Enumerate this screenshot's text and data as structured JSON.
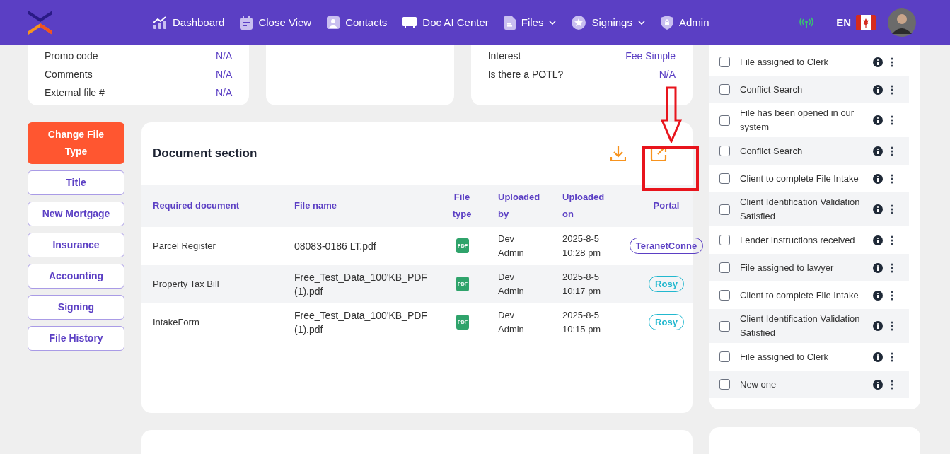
{
  "nav": {
    "items": [
      {
        "label": "Dashboard",
        "dropdown": false
      },
      {
        "label": "Close View",
        "dropdown": false
      },
      {
        "label": "Contacts",
        "dropdown": false
      },
      {
        "label": "Doc AI Center",
        "dropdown": false
      },
      {
        "label": "Files",
        "dropdown": true
      },
      {
        "label": "Signings",
        "dropdown": true
      },
      {
        "label": "Admin",
        "dropdown": false
      }
    ],
    "language": "EN"
  },
  "summary_cards": [
    {
      "rows": [
        {
          "label": "Promo code",
          "value": "N/A"
        },
        {
          "label": "Comments",
          "value": "N/A"
        },
        {
          "label": "External file #",
          "value": "N/A"
        }
      ]
    },
    {
      "rows": [
        {
          "label": "Interest",
          "value": "Fee Simple"
        },
        {
          "label": "Is there a POTL?",
          "value": "N/A"
        }
      ]
    }
  ],
  "side_buttons": [
    {
      "label": "Change File Type",
      "kind": "primary"
    },
    {
      "label": "Title",
      "kind": "outline"
    },
    {
      "label": "New Mortgage",
      "kind": "outline"
    },
    {
      "label": "Insurance",
      "kind": "outline"
    },
    {
      "label": "Accounting",
      "kind": "outline"
    },
    {
      "label": "Signing",
      "kind": "outline"
    },
    {
      "label": "File History",
      "kind": "outline"
    }
  ],
  "document_section": {
    "title": "Document section",
    "columns": [
      "Required document",
      "File name",
      "File type",
      "Uploaded by",
      "Uploaded on",
      "Portal"
    ],
    "rows": [
      {
        "required": "Parcel Register",
        "file_name": "08083-0186 LT.pdf",
        "file_type": "PDF",
        "uploaded_by": "Dev Admin",
        "uploaded_on": "2025-8-5 10:28 pm",
        "portal": "TeranetConne",
        "color": "#5b3fc4"
      },
      {
        "required": "Property Tax Bill",
        "file_name": "Free_Test_Data_100'KB_PDF (1).pdf",
        "file_type": "PDF",
        "uploaded_by": "Dev Admin",
        "uploaded_on": "2025-8-5 10:17 pm",
        "portal": "Rosy",
        "color": "#22b8cf"
      },
      {
        "required": "IntakeForm",
        "file_name": "Free_Test_Data_100'KB_PDF (1).pdf",
        "file_type": "PDF",
        "uploaded_by": "Dev Admin",
        "uploaded_on": "2025-8-5 10:15 pm",
        "portal": "Rosy",
        "color": "#22b8cf"
      }
    ]
  },
  "tasks": [
    {
      "label": "File assigned to Clerk",
      "checked": false
    },
    {
      "label": "Conflict Search",
      "checked": false
    },
    {
      "label": "File has been opened in our system",
      "checked": false
    },
    {
      "label": "Conflict Search",
      "checked": false
    },
    {
      "label": "Client to complete File Intake",
      "checked": false
    },
    {
      "label": "Client Identification Validation Satisfied",
      "checked": false
    },
    {
      "label": "Lender instructions received",
      "checked": false
    },
    {
      "label": "File assigned to lawyer",
      "checked": false
    },
    {
      "label": "Client to complete File Intake",
      "checked": false
    },
    {
      "label": "Client Identification Validation Satisfied",
      "checked": false
    },
    {
      "label": "File assigned to Clerk",
      "checked": false
    },
    {
      "label": "New one",
      "checked": false
    }
  ]
}
